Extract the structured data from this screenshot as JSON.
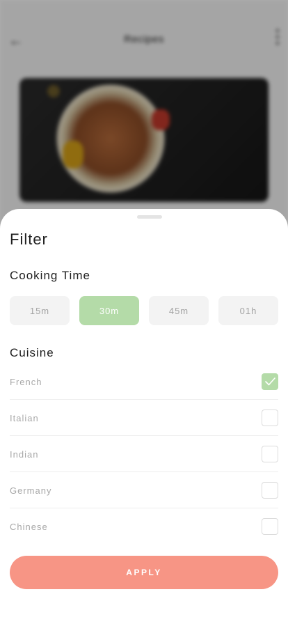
{
  "background": {
    "title": "Recipes",
    "back_icon": "arrow-left-icon",
    "more_icon": "more-vertical-icon"
  },
  "filter": {
    "title": "Filter",
    "cooking_time": {
      "title": "Cooking Time",
      "options": [
        "15m",
        "30m",
        "45m",
        "01h"
      ],
      "selected": "30m"
    },
    "cuisine": {
      "title": "Cuisine",
      "items": [
        {
          "label": "French",
          "checked": true
        },
        {
          "label": "Italian",
          "checked": false
        },
        {
          "label": "Indian",
          "checked": false
        },
        {
          "label": "Germany",
          "checked": false
        },
        {
          "label": "Chinese",
          "checked": false
        }
      ]
    },
    "apply_label": "APPLY"
  },
  "colors": {
    "accent_green": "#b4dba8",
    "apply_button": "#f79585",
    "chip_background": "#f3f3f3"
  }
}
